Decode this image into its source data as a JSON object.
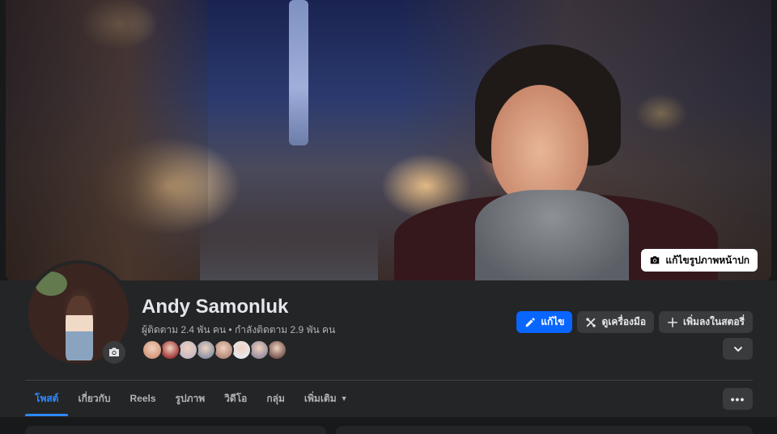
{
  "cover": {
    "edit_label": "แก้ไขรูปภาพหน้าปก"
  },
  "profile": {
    "name": "Andy Samonluk",
    "followers": "ผู้ติดตาม 2.4 พัน คน",
    "separator": " • ",
    "following": "กำลังติดตาม 2.9 พัน คน",
    "friend_avatar_colors": [
      "#d59a7c",
      "#a33a3a",
      "#c7b8c3",
      "#8e96a6",
      "#b58a7a",
      "#e6e8ee",
      "#9a8fa0",
      "#7a5a55"
    ]
  },
  "actions": {
    "edit_label": "แก้ไข",
    "tools_label": "ดูเครื่องมือ",
    "add_story_label": "เพิ่มลงในสตอรี่"
  },
  "tabs": [
    {
      "label": "โพสต์"
    },
    {
      "label": "เกี่ยวกับ"
    },
    {
      "label": "Reels"
    },
    {
      "label": "รูปภาพ"
    },
    {
      "label": "วิดีโอ"
    },
    {
      "label": "กลุ่ม"
    },
    {
      "label": "เพิ่มเติม"
    }
  ],
  "more_label": "•••",
  "colors": {
    "accent": "#0866ff",
    "active_tab": "#2d88ff",
    "surface": "#242526",
    "background": "#18191a",
    "secondary_button": "#3a3b3c"
  }
}
